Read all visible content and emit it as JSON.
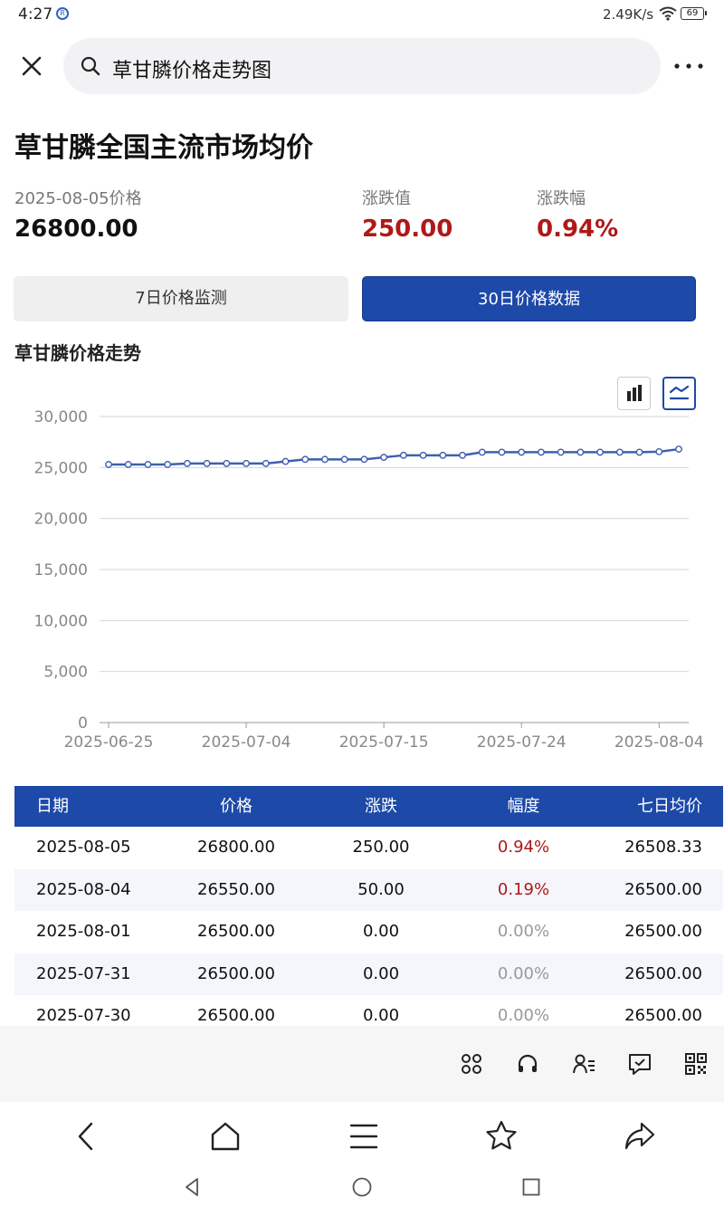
{
  "status": {
    "time": "4:27",
    "notif": "R",
    "speed": "2.49K/s",
    "battery": "69"
  },
  "search": {
    "query": "草甘膦价格走势图"
  },
  "page": {
    "title": "草甘膦全国主流市场均价",
    "price_label": "2025-08-05价格",
    "price_value": "26800.00",
    "change_label": "涨跌值",
    "change_value": "250.00",
    "pct_label": "涨跌幅",
    "pct_value": "0.94%"
  },
  "tabs": {
    "tab_7d": "7日价格监测",
    "tab_30d": "30日价格数据"
  },
  "section": {
    "trend_title": "草甘膦价格走势"
  },
  "colors": {
    "accent": "#1d49a8",
    "up": "#b01818",
    "line": "#3f5fb0"
  },
  "chart_data": {
    "type": "line",
    "x": [
      "2025-06-25",
      "2025-06-26",
      "2025-06-27",
      "2025-06-30",
      "2025-07-01",
      "2025-07-02",
      "2025-07-03",
      "2025-07-04",
      "2025-07-07",
      "2025-07-08",
      "2025-07-09",
      "2025-07-10",
      "2025-07-11",
      "2025-07-14",
      "2025-07-15",
      "2025-07-16",
      "2025-07-17",
      "2025-07-18",
      "2025-07-21",
      "2025-07-22",
      "2025-07-23",
      "2025-07-24",
      "2025-07-25",
      "2025-07-28",
      "2025-07-29",
      "2025-07-30",
      "2025-07-31",
      "2025-08-01",
      "2025-08-04",
      "2025-08-05"
    ],
    "values": [
      25300,
      25300,
      25300,
      25300,
      25400,
      25400,
      25400,
      25400,
      25400,
      25600,
      25800,
      25800,
      25800,
      25800,
      26000,
      26200,
      26200,
      26200,
      26200,
      26500,
      26500,
      26500,
      26500,
      26500,
      26500,
      26500,
      26500,
      26500,
      26550,
      26800
    ],
    "xticks": [
      "2025-06-25",
      "2025-07-04",
      "2025-07-15",
      "2025-07-24",
      "2025-08-04"
    ],
    "yticks": [
      "0",
      "5,000",
      "10,000",
      "15,000",
      "20,000",
      "25,000",
      "30,000"
    ],
    "ylim": [
      0,
      30000
    ],
    "grid": true,
    "title": "",
    "xlabel": "",
    "ylabel": ""
  },
  "table": {
    "headers": [
      "日期",
      "价格",
      "涨跌",
      "幅度",
      "七日均价"
    ],
    "rows": [
      {
        "date": "2025-08-05",
        "price": "26800.00",
        "change": "250.00",
        "pct": "0.94%",
        "avg7": "26508.33"
      },
      {
        "date": "2025-08-04",
        "price": "26550.00",
        "change": "50.00",
        "pct": "0.19%",
        "avg7": "26500.00"
      },
      {
        "date": "2025-08-01",
        "price": "26500.00",
        "change": "0.00",
        "pct": "0.00%",
        "avg7": "26500.00"
      },
      {
        "date": "2025-07-31",
        "price": "26500.00",
        "change": "0.00",
        "pct": "0.00%",
        "avg7": "26500.00"
      },
      {
        "date": "2025-07-30",
        "price": "26500.00",
        "change": "0.00",
        "pct": "0.00%",
        "avg7": "26500.00"
      }
    ]
  },
  "toolbar_icons": [
    "apps-icon",
    "headset-icon",
    "profile-list-icon",
    "feedback-icon",
    "qr-code-icon"
  ],
  "nav_icons": [
    "back-icon",
    "home-icon",
    "menu-icon",
    "star-icon",
    "share-icon"
  ]
}
